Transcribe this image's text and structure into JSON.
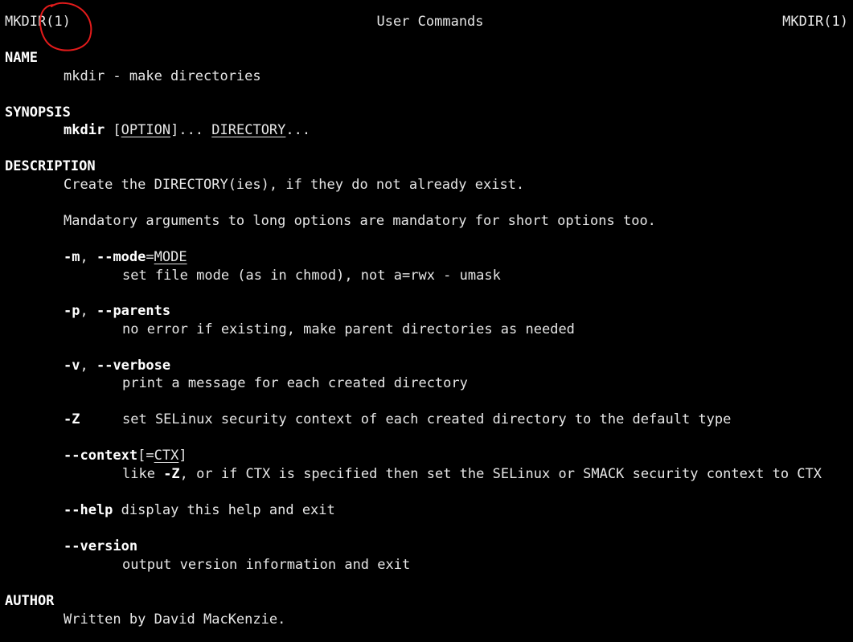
{
  "header": {
    "left": "MKDIR(1)",
    "center": "User Commands",
    "right": "MKDIR(1)"
  },
  "sections": {
    "name": {
      "heading": "NAME",
      "text": "mkdir - make directories"
    },
    "synopsis": {
      "heading": "SYNOPSIS",
      "command": "mkdir",
      "option": "OPTION",
      "ellipsis_1": "]... ",
      "bracket_open": " [",
      "directory": "DIRECTORY",
      "ellipsis_2": "..."
    },
    "description": {
      "heading": "DESCRIPTION",
      "line1": "Create the DIRECTORY(ies), if they do not already exist.",
      "line2": "Mandatory arguments to long options are mandatory for short options too.",
      "options": {
        "mode": {
          "short": "-m",
          "sep": ", ",
          "long": "--mode",
          "eq": "=",
          "arg": "MODE",
          "desc": "set file mode (as in chmod), not a=rwx - umask"
        },
        "parents": {
          "short": "-p",
          "sep": ", ",
          "long": "--parents",
          "desc": "no error if existing, make parent directories as needed"
        },
        "verbose": {
          "short": "-v",
          "sep": ", ",
          "long": "--verbose",
          "desc": "print a message for each created directory"
        },
        "z": {
          "short": "-Z",
          "desc": "set SELinux security context of each created directory to the default type"
        },
        "context": {
          "long": "--context",
          "bracket_open": "[",
          "eq": "=",
          "arg": "CTX",
          "bracket_close": "]",
          "desc_pre": "like ",
          "desc_flag": "-Z",
          "desc_post": ", or if CTX is specified then set the SELinux or SMACK security context to CTX"
        },
        "help": {
          "long": "--help",
          "desc": " display this help and exit"
        },
        "version": {
          "long": "--version",
          "desc": "output version information and exit"
        }
      }
    },
    "author": {
      "heading": "AUTHOR",
      "text": "Written by David MacKenzie."
    }
  },
  "colors": {
    "background": "#000000",
    "text": "#e6e6e6",
    "bold": "#ffffff",
    "annotation": "#e31b1b"
  }
}
